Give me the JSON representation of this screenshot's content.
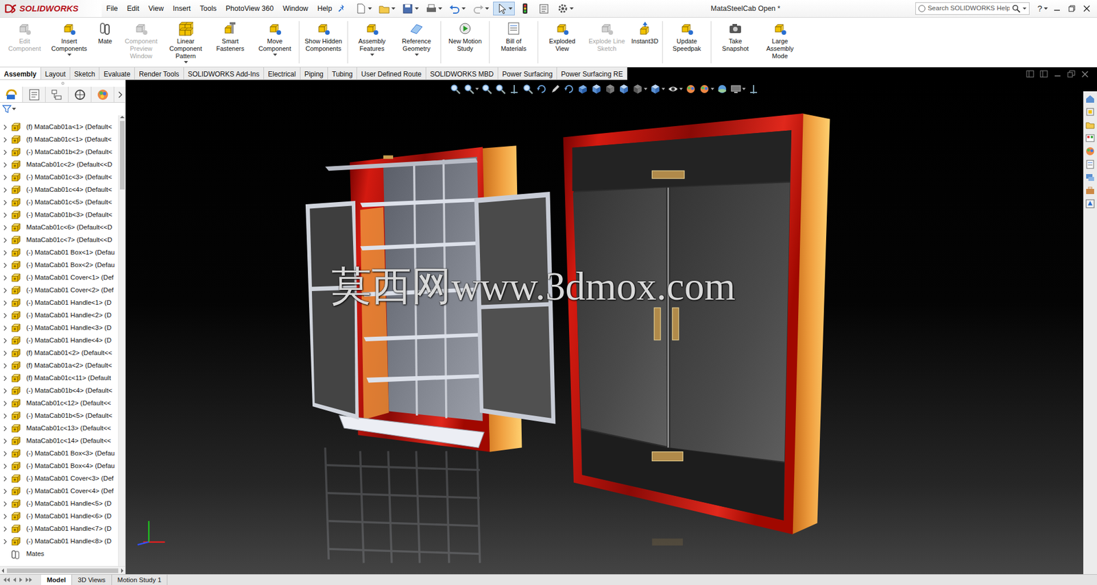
{
  "window": {
    "title": "MataSteelCab Open *"
  },
  "app": {
    "logo": "SOLIDWORKS"
  },
  "menu": [
    "File",
    "Edit",
    "View",
    "Insert",
    "Tools",
    "PhotoView 360",
    "Window",
    "Help"
  ],
  "quick_access": {
    "select_active": true
  },
  "search": {
    "placeholder": "Search SOLIDWORKS Help"
  },
  "help": "?",
  "ribbon": [
    {
      "label": "Edit Component",
      "disabled": true,
      "dropdown": false
    },
    {
      "label": "Insert Components",
      "disabled": false,
      "dropdown": true
    },
    {
      "label": "Mate",
      "disabled": false,
      "dropdown": false
    },
    {
      "label": "Component Preview Window",
      "disabled": true,
      "dropdown": false
    },
    {
      "label": "Linear Component Pattern",
      "disabled": false,
      "dropdown": true
    },
    {
      "label": "Smart Fasteners",
      "disabled": false,
      "dropdown": false
    },
    {
      "label": "Move Component",
      "disabled": false,
      "dropdown": true
    },
    {
      "label": "Show Hidden Components",
      "disabled": false,
      "dropdown": false
    },
    {
      "label": "Assembly Features",
      "disabled": false,
      "dropdown": true
    },
    {
      "label": "Reference Geometry",
      "disabled": false,
      "dropdown": true
    },
    {
      "label": "New Motion Study",
      "disabled": false,
      "dropdown": false
    },
    {
      "label": "Bill of Materials",
      "disabled": false,
      "dropdown": false
    },
    {
      "label": "Exploded View",
      "disabled": false,
      "dropdown": false
    },
    {
      "label": "Explode Line Sketch",
      "disabled": true,
      "dropdown": false
    },
    {
      "label": "Instant3D",
      "disabled": false,
      "dropdown": false
    },
    {
      "label": "Update Speedpak",
      "disabled": false,
      "dropdown": false
    },
    {
      "label": "Take Snapshot",
      "disabled": false,
      "dropdown": false
    },
    {
      "label": "Large Assembly Mode",
      "disabled": false,
      "dropdown": false
    }
  ],
  "tabs": [
    {
      "label": "Assembly",
      "selected": true
    },
    {
      "label": "Layout",
      "selected": false
    },
    {
      "label": "Sketch",
      "selected": false
    },
    {
      "label": "Evaluate",
      "selected": false
    },
    {
      "label": "Render Tools",
      "selected": false
    },
    {
      "label": "SOLIDWORKS Add-Ins",
      "selected": false
    },
    {
      "label": "Electrical",
      "selected": false
    },
    {
      "label": "Piping",
      "selected": false
    },
    {
      "label": "Tubing",
      "selected": false
    },
    {
      "label": "User Defined Route",
      "selected": false
    },
    {
      "label": "SOLIDWORKS MBD",
      "selected": false
    },
    {
      "label": "Power Surfacing",
      "selected": false
    },
    {
      "label": "Power Surfacing RE",
      "selected": false
    }
  ],
  "panel_tabs": [
    {
      "selected": true
    },
    {
      "selected": false
    },
    {
      "selected": false
    },
    {
      "selected": false
    },
    {
      "selected": false
    }
  ],
  "tree": {
    "items": [
      {
        "label": "(f) MataCab01a<1> (Default<",
        "kind": "component",
        "expanded": false
      },
      {
        "label": "(f) MataCab01c<1> (Default<",
        "kind": "component",
        "expanded": false
      },
      {
        "label": "(-) MataCab01b<2> (Default<",
        "kind": "component",
        "expanded": false
      },
      {
        "label": "MataCab01c<2> (Default<<D",
        "kind": "component",
        "expanded": false
      },
      {
        "label": "(-) MataCab01c<3> (Default<",
        "kind": "component",
        "expanded": false
      },
      {
        "label": "(-) MataCab01c<4> (Default<",
        "kind": "component",
        "expanded": false
      },
      {
        "label": "(-) MataCab01c<5> (Default<",
        "kind": "component",
        "expanded": false
      },
      {
        "label": "(-) MataCab01b<3> (Default<",
        "kind": "component",
        "expanded": false
      },
      {
        "label": "MataCab01c<6> (Default<<D",
        "kind": "component",
        "expanded": false
      },
      {
        "label": "MataCab01c<7> (Default<<D",
        "kind": "component",
        "expanded": false
      },
      {
        "label": "(-) MataCab01 Box<1> (Defau",
        "kind": "component",
        "expanded": false
      },
      {
        "label": "(-) MataCab01 Box<2> (Defau",
        "kind": "component",
        "expanded": false
      },
      {
        "label": "(-) MataCab01 Cover<1> (Def",
        "kind": "component",
        "expanded": false
      },
      {
        "label": "(-) MataCab01 Cover<2> (Def",
        "kind": "component",
        "expanded": false
      },
      {
        "label": "(-) MataCab01 Handle<1> (D",
        "kind": "component",
        "expanded": false
      },
      {
        "label": "(-) MataCab01 Handle<2> (D",
        "kind": "component",
        "expanded": false
      },
      {
        "label": "(-) MataCab01 Handle<3> (D",
        "kind": "component",
        "expanded": false
      },
      {
        "label": "(-) MataCab01 Handle<4> (D",
        "kind": "component",
        "expanded": false
      },
      {
        "label": "(f) MataCab01<2> (Default<<",
        "kind": "component",
        "expanded": false
      },
      {
        "label": "(f) MataCab01a<2> (Default<",
        "kind": "component",
        "expanded": false
      },
      {
        "label": "(f) MataCab01c<11> (Default",
        "kind": "component",
        "expanded": false
      },
      {
        "label": "(-) MataCab01b<4> (Default<",
        "kind": "component",
        "expanded": false
      },
      {
        "label": "MataCab01c<12> (Default<<",
        "kind": "component",
        "expanded": false
      },
      {
        "label": "(-) MataCab01b<5> (Default<",
        "kind": "component",
        "expanded": false
      },
      {
        "label": "MataCab01c<13> (Default<<",
        "kind": "component",
        "expanded": false
      },
      {
        "label": "MataCab01c<14> (Default<<",
        "kind": "component",
        "expanded": false
      },
      {
        "label": "(-) MataCab01 Box<3> (Defau",
        "kind": "component",
        "expanded": false
      },
      {
        "label": "(-) MataCab01 Box<4> (Defau",
        "kind": "component",
        "expanded": false
      },
      {
        "label": "(-) MataCab01 Cover<3> (Def",
        "kind": "component",
        "expanded": false
      },
      {
        "label": "(-) MataCab01 Cover<4> (Def",
        "kind": "component",
        "expanded": false
      },
      {
        "label": "(-) MataCab01 Handle<5> (D",
        "kind": "component",
        "expanded": false
      },
      {
        "label": "(-) MataCab01 Handle<6> (D",
        "kind": "component",
        "expanded": false
      },
      {
        "label": "(-) MataCab01 Handle<7> (D",
        "kind": "component",
        "expanded": false
      },
      {
        "label": "(-) MataCab01 Handle<8> (D",
        "kind": "component",
        "expanded": false
      },
      {
        "label": "Mates",
        "kind": "mates"
      }
    ]
  },
  "viewport": {
    "watermark": "莫西网www.3dmox.com"
  },
  "bottom_tabs": [
    {
      "label": "Model",
      "selected": true
    },
    {
      "label": "3D Views",
      "selected": false
    },
    {
      "label": "Motion Study 1",
      "selected": false
    }
  ]
}
